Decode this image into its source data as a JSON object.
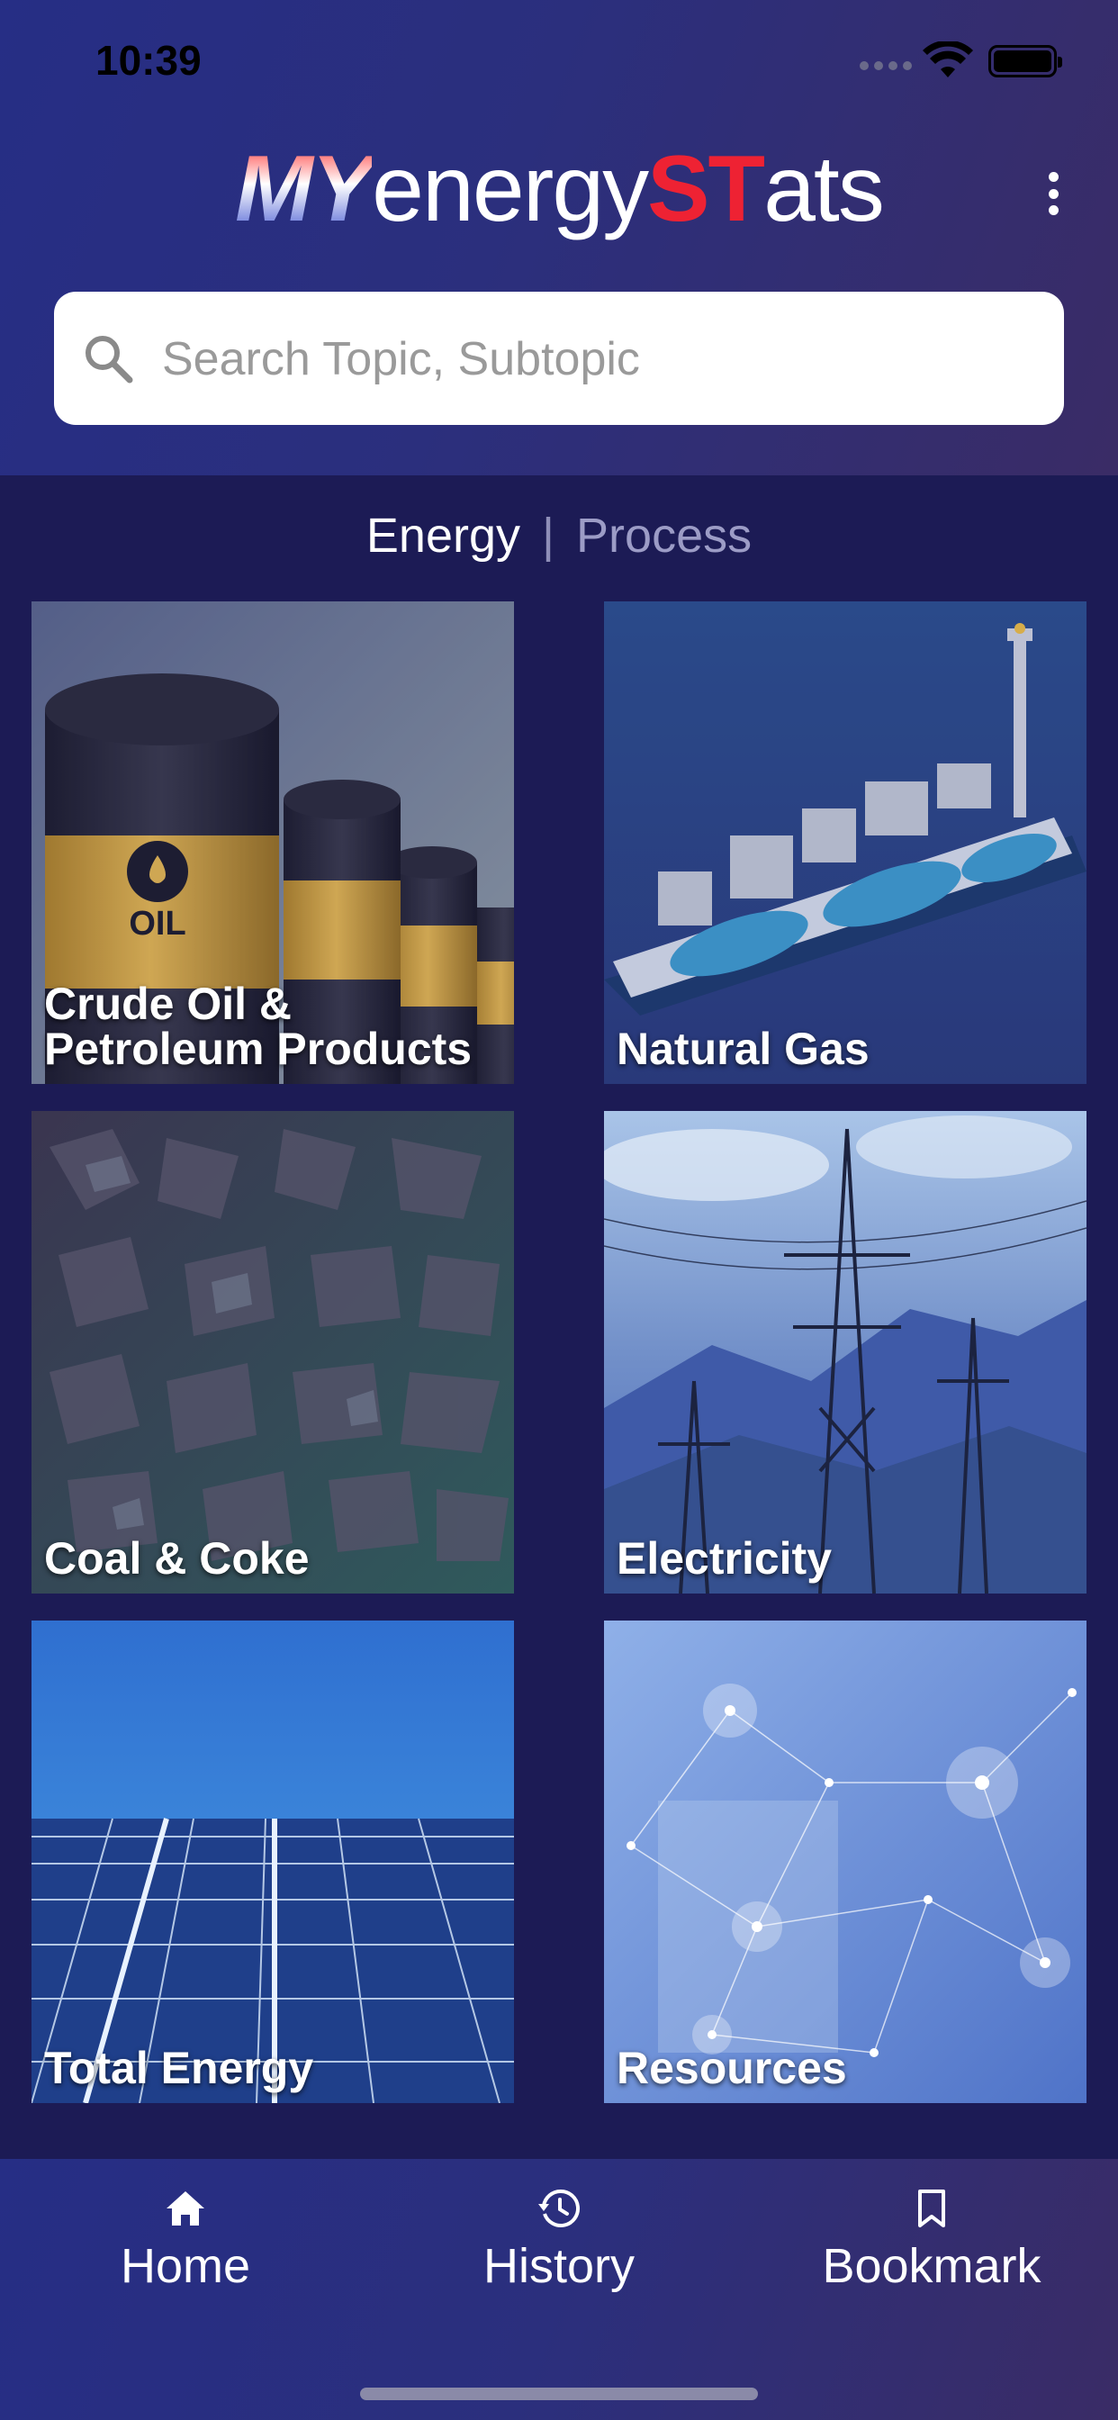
{
  "status_bar": {
    "time": "10:39"
  },
  "header": {
    "logo": {
      "part1": "MY",
      "part2": "energy",
      "part3": "ST",
      "part4": "ats"
    },
    "menu_icon": "more-vertical-icon"
  },
  "search": {
    "placeholder": "Search Topic, Subtopic",
    "value": ""
  },
  "toggle": {
    "active": "Energy",
    "separator": "|",
    "inactive": "Process"
  },
  "tiles": [
    {
      "label": "Crude Oil & Petroleum Products",
      "line1": "Crude Oil &",
      "line2": "Petroleum Products",
      "oil_text": "OIL"
    },
    {
      "label": "Natural Gas"
    },
    {
      "label": "Coal & Coke"
    },
    {
      "label": "Electricity"
    },
    {
      "label": "Total Energy"
    },
    {
      "label": "Resources"
    }
  ],
  "bottom_nav": [
    {
      "label": "Home",
      "icon": "home-icon"
    },
    {
      "label": "History",
      "icon": "history-icon"
    },
    {
      "label": "Bookmark",
      "icon": "bookmark-icon"
    }
  ],
  "colors": {
    "accent_red": "#ee2233",
    "background": "#1c1b55",
    "header": "#2b2f7d"
  }
}
